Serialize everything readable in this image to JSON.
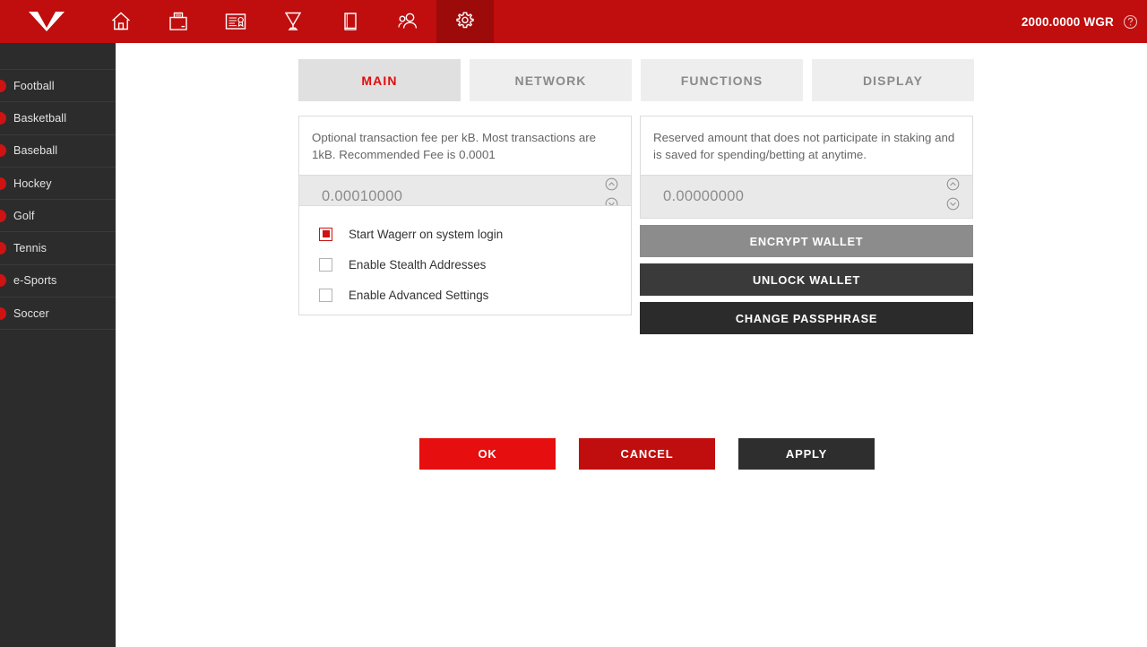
{
  "header": {
    "brand_icon": "wagerr-w-logo",
    "nav": [
      {
        "name": "home-icon",
        "label": "Home",
        "active": false
      },
      {
        "name": "wallet-icon",
        "label": "Wallet",
        "active": false
      },
      {
        "name": "bet-slip-icon",
        "label": "Betting",
        "active": false
      },
      {
        "name": "trophy-icon",
        "label": "Leagues",
        "active": false
      },
      {
        "name": "book-icon",
        "label": "Guide",
        "active": false
      },
      {
        "name": "users-icon",
        "label": "Community",
        "active": false
      },
      {
        "name": "gear-icon",
        "label": "Settings",
        "active": true
      }
    ],
    "balance": "2000.0000 WGR",
    "help_icon": "question-mark-circle-icon"
  },
  "sidebar": {
    "items": [
      {
        "label": "Football",
        "icon": "sport-dot-icon"
      },
      {
        "label": "Basketball",
        "icon": "sport-dot-icon"
      },
      {
        "label": "Baseball",
        "icon": "sport-dot-icon"
      },
      {
        "label": "Hockey",
        "icon": "sport-dot-icon"
      },
      {
        "label": "Golf",
        "icon": "sport-dot-icon"
      },
      {
        "label": "Tennis",
        "icon": "sport-dot-icon"
      },
      {
        "label": "e-Sports",
        "icon": "sport-dot-icon"
      },
      {
        "label": "Soccer",
        "icon": "sport-dot-icon"
      }
    ]
  },
  "tabs": [
    {
      "label": "MAIN",
      "active": true
    },
    {
      "label": "NETWORK",
      "active": false
    },
    {
      "label": "FUNCTIONS",
      "active": false
    },
    {
      "label": "DISPLAY",
      "active": false
    }
  ],
  "fee_panel": {
    "description": "Optional transaction fee per kB. Most transactions are 1kB. Recommended Fee is 0.0001",
    "value": "0.00010000"
  },
  "reserve_panel": {
    "description": "Reserved amount that does not participate in staking and is saved for spending/betting at anytime.",
    "value": "0.00000000"
  },
  "checkboxes": [
    {
      "label": "Start Wagerr on system login",
      "checked": true
    },
    {
      "label": "Enable Stealth Addresses",
      "checked": false
    },
    {
      "label": "Enable Advanced Settings",
      "checked": false
    }
  ],
  "wallet_buttons": [
    {
      "label": "ENCRYPT WALLET",
      "color": "#8c8c8c"
    },
    {
      "label": "UNLOCK WALLET",
      "color": "#3a3a3a"
    },
    {
      "label": "CHANGE PASSPHRASE",
      "color": "#2b2b2b"
    }
  ],
  "footer_buttons": [
    {
      "label": "OK",
      "color": "#e60e0e"
    },
    {
      "label": "CANCEL",
      "color": "#c00d0d"
    },
    {
      "label": "APPLY",
      "color": "#2e2e2e"
    }
  ],
  "colors": {
    "brand_red": "#c00d0d",
    "active_red": "#9d0a0a",
    "accent_red": "#e00c0c",
    "sidebar_bg": "#2c2c2c",
    "tab_inactive": "#eeeeee",
    "tab_active": "#e0e0e0",
    "field_bg": "#e9e9e9"
  }
}
